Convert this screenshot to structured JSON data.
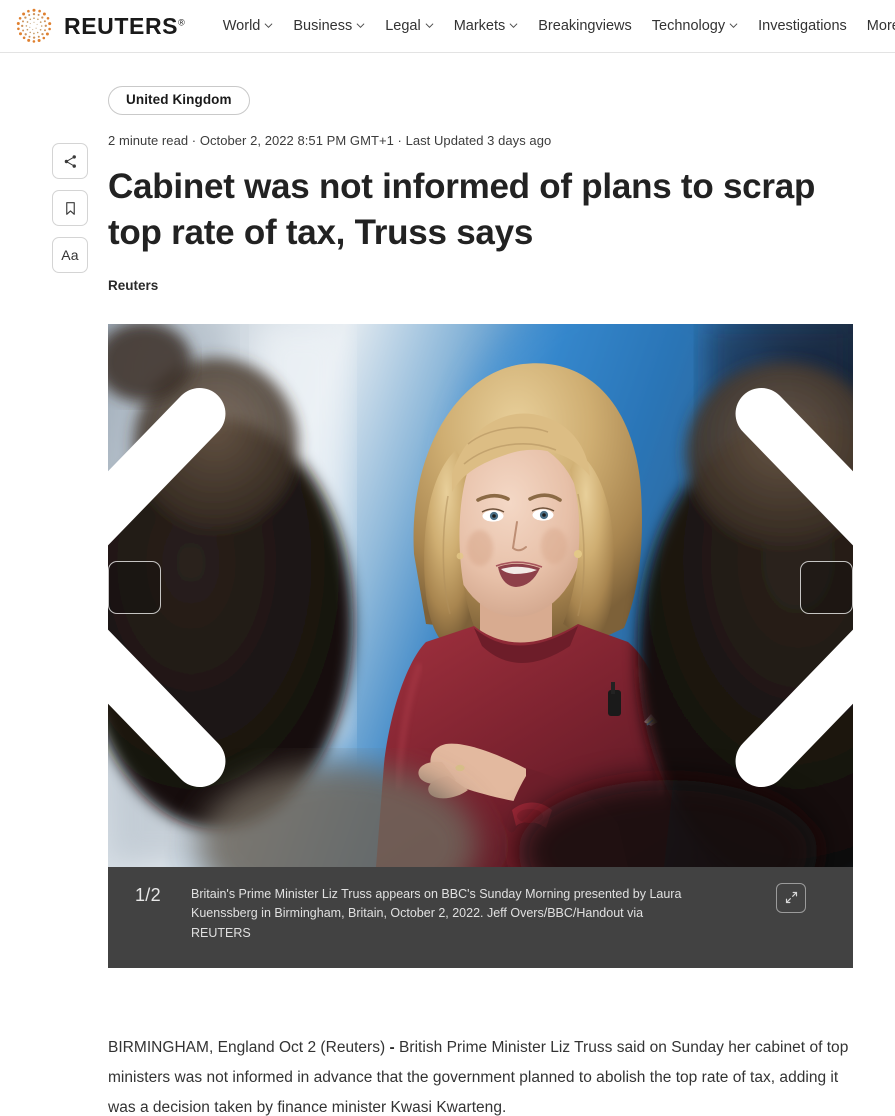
{
  "header": {
    "logo_word": "REUTERS",
    "logo_reg": "®",
    "nav": [
      {
        "label": "World",
        "has_chevron": true
      },
      {
        "label": "Business",
        "has_chevron": true
      },
      {
        "label": "Legal",
        "has_chevron": true
      },
      {
        "label": "Markets",
        "has_chevron": true
      },
      {
        "label": "Breakingviews",
        "has_chevron": false
      },
      {
        "label": "Technology",
        "has_chevron": true
      },
      {
        "label": "Investigations",
        "has_chevron": false
      },
      {
        "label": "More",
        "has_chevron": true
      }
    ],
    "grid_icon": "layout-grid-icon"
  },
  "rail": {
    "share_icon": "share-icon",
    "bookmark_icon": "bookmark-icon",
    "textsize_label": "Aa"
  },
  "article": {
    "kicker": "United Kingdom",
    "meta": "2 minute read · October 2, 2022 8:51 PM GMT+1 · Last Updated 3 days ago",
    "headline": "Cabinet was not informed of plans to scrap top rate of tax, Truss says",
    "byline": "Reuters"
  },
  "media": {
    "prev_icon": "chevron-left-icon",
    "next_icon": "chevron-right-icon",
    "expand_icon": "expand-arrows-icon",
    "counter": "1/2",
    "caption": "Britain's Prime Minister Liz Truss appears on BBC's Sunday Morning presented by Laura Kuenssberg in Birmingham, Britain, October 2, 2022. Jeff Overs/BBC/Handout via REUTERS"
  },
  "body": {
    "dateline": "BIRMINGHAM, England Oct 2 (Reuters)",
    "dash": "-",
    "paragraph": " British Prime Minister Liz Truss said on Sunday her cabinet of top ministers was not informed in advance that the government planned to abolish the top rate of tax, adding it was a decision taken by finance minister Kwasi Kwarteng."
  },
  "colors": {
    "brand_orange": "#e07b2a",
    "caption_bar": "#424242",
    "text_dark": "#333333",
    "border_light": "#e3e3e3"
  }
}
